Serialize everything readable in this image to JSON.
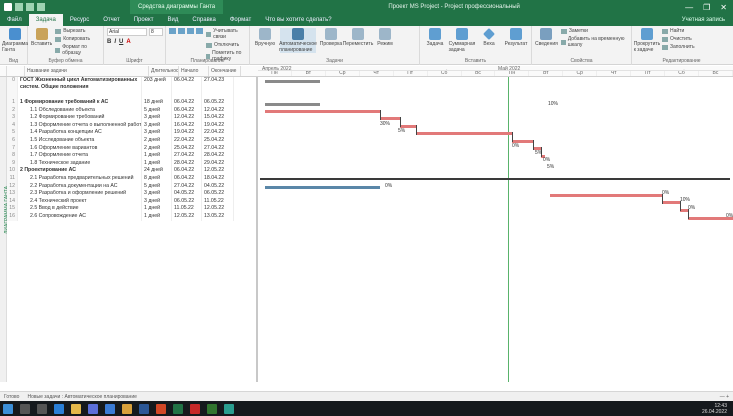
{
  "titlebar": {
    "context_tab": "Средства диаграммы Ганта",
    "document_title": "Проект MS Project - Project профессиональный",
    "controls": [
      "—",
      "❐",
      "✕"
    ]
  },
  "menu": {
    "items": [
      "Файл",
      "Задача",
      "Ресурс",
      "Отчет",
      "Проект",
      "Вид",
      "Справка",
      "Формат"
    ],
    "active_index": 1,
    "search": "Что вы хотите сделать?",
    "user": "Учетная запись"
  },
  "ribbon": {
    "groups": [
      {
        "label": "Вид",
        "buttons": [
          "Диаграмма Ганта"
        ]
      },
      {
        "label": "Буфер обмена",
        "buttons": [
          "Вставить"
        ],
        "small": [
          "Вырезать",
          "Копировать",
          "Формат по образцу"
        ]
      },
      {
        "label": "Шрифт",
        "font_name": "Arial",
        "font_size": "8"
      },
      {
        "label": "Планирование",
        "small": [
          "Учитывать связи",
          "Отключить",
          "Пометить по графику"
        ]
      },
      {
        "label": "Задачи",
        "buttons": [
          "Вручную",
          "Автоматическое планирование",
          "Проверка",
          "Переместить",
          "Режим"
        ]
      },
      {
        "label": "Вставить",
        "buttons": [
          "Задача",
          "Суммарная задача",
          "Веха",
          "Результат"
        ]
      },
      {
        "label": "Свойства",
        "buttons": [
          "Сведения",
          "Заметки",
          "Добавить на временную шкалу"
        ]
      },
      {
        "label": "Редактирование",
        "small": [
          "Прокрутить к задаче",
          "Найти",
          "Очистить",
          "Заполнить"
        ]
      }
    ]
  },
  "columns": {
    "name": "Название задачи",
    "duration": "Длительность",
    "start": "Начало",
    "finish": "Окончание"
  },
  "timescale": {
    "months": [
      "Апрель 2022",
      "Май 2022"
    ],
    "days": [
      "Пн",
      "Вт",
      "Ср",
      "Чт",
      "Пт",
      "Сб",
      "Вс",
      "Пн",
      "Вт",
      "Ср",
      "Чт",
      "Пт",
      "Сб",
      "Вс"
    ]
  },
  "view_label": "ДИАГРАММА ГАНТА",
  "tasks": [
    {
      "num": "0",
      "name": "ГОСТ Жизненный цикл Автоматизированных систем. Общие положения",
      "duration": "203 дней",
      "start": "06.04.22",
      "finish": "27.04.23",
      "summary": true,
      "tall": true
    },
    {
      "num": "1",
      "name": "1 Формирование требований к АС",
      "duration": "18 дней",
      "start": "06.04.22",
      "finish": "06.05.22",
      "summary": true
    },
    {
      "num": "2",
      "name": "1.1 Обследование объекта",
      "duration": "5 дней",
      "start": "06.04.22",
      "finish": "12.04.22",
      "indent": 2
    },
    {
      "num": "3",
      "name": "1.2 Формирование требований",
      "duration": "3 дней",
      "start": "12.04.22",
      "finish": "15.04.22",
      "indent": 2
    },
    {
      "num": "4",
      "name": "1.3 Оформление отчета о выполненной работе",
      "duration": "3 дней",
      "start": "16.04.22",
      "finish": "19.04.22",
      "indent": 2
    },
    {
      "num": "5",
      "name": "1.4 Разработка концепции АС",
      "duration": "3 дней",
      "start": "19.04.22",
      "finish": "22.04.22",
      "indent": 2
    },
    {
      "num": "6",
      "name": "1.5 Исследование объекта",
      "duration": "2 дней",
      "start": "22.04.22",
      "finish": "25.04.22",
      "indent": 2
    },
    {
      "num": "7",
      "name": "1.6 Оформление вариантов",
      "duration": "2 дней",
      "start": "25.04.22",
      "finish": "27.04.22",
      "indent": 2
    },
    {
      "num": "8",
      "name": "1.7 Оформление отчета",
      "duration": "1 дней",
      "start": "27.04.22",
      "finish": "28.04.22",
      "indent": 2
    },
    {
      "num": "9",
      "name": "1.8 Техническое задание",
      "duration": "1 дней",
      "start": "28.04.22",
      "finish": "29.04.22",
      "indent": 2
    },
    {
      "num": "10",
      "name": "2 Проектирование АС",
      "duration": "24 дней",
      "start": "06.04.22",
      "finish": "12.05.22",
      "summary": true
    },
    {
      "num": "11",
      "name": "2.1 Разработка предварительных решений",
      "duration": "8 дней",
      "start": "06.04.22",
      "finish": "18.04.22",
      "indent": 2
    },
    {
      "num": "12",
      "name": "2.2 Разработка документации на АС",
      "duration": "5 дней",
      "start": "27.04.22",
      "finish": "04.05.22",
      "indent": 2
    },
    {
      "num": "13",
      "name": "2.3 Разработка и оформление решений",
      "duration": "3 дней",
      "start": "04.05.22",
      "finish": "06.05.22",
      "indent": 2
    },
    {
      "num": "14",
      "name": "2.4 Технический проект",
      "duration": "3 дней",
      "start": "06.05.22",
      "finish": "11.05.22",
      "indent": 2
    },
    {
      "num": "15",
      "name": "2.5 Ввод в действие",
      "duration": "1 дней",
      "start": "11.05.22",
      "finish": "12.05.22",
      "indent": 2
    },
    {
      "num": "16",
      "name": "2.6 Сопровождение АС",
      "duration": "1 дней",
      "start": "12.05.22",
      "finish": "13.05.22",
      "indent": 2
    }
  ],
  "gantt_labels": [
    "10%",
    "30%",
    "5%",
    "0%",
    "5%",
    "0%",
    "5%",
    "0%",
    "0%",
    "10%",
    "0%",
    "0%"
  ],
  "statusbar": {
    "left": "Готово",
    "mode": "Новые задачи : Автоматическое планирование",
    "zoom": "—  +"
  },
  "taskbar": {
    "time": "12:43",
    "date": "26.04.2022"
  },
  "colors": {
    "brand": "#217346",
    "gantt_bar": "#e27979",
    "summary_bar": "#8a8a8a",
    "progress_bar": "#5a87a8",
    "today_line": "#59b36b"
  }
}
